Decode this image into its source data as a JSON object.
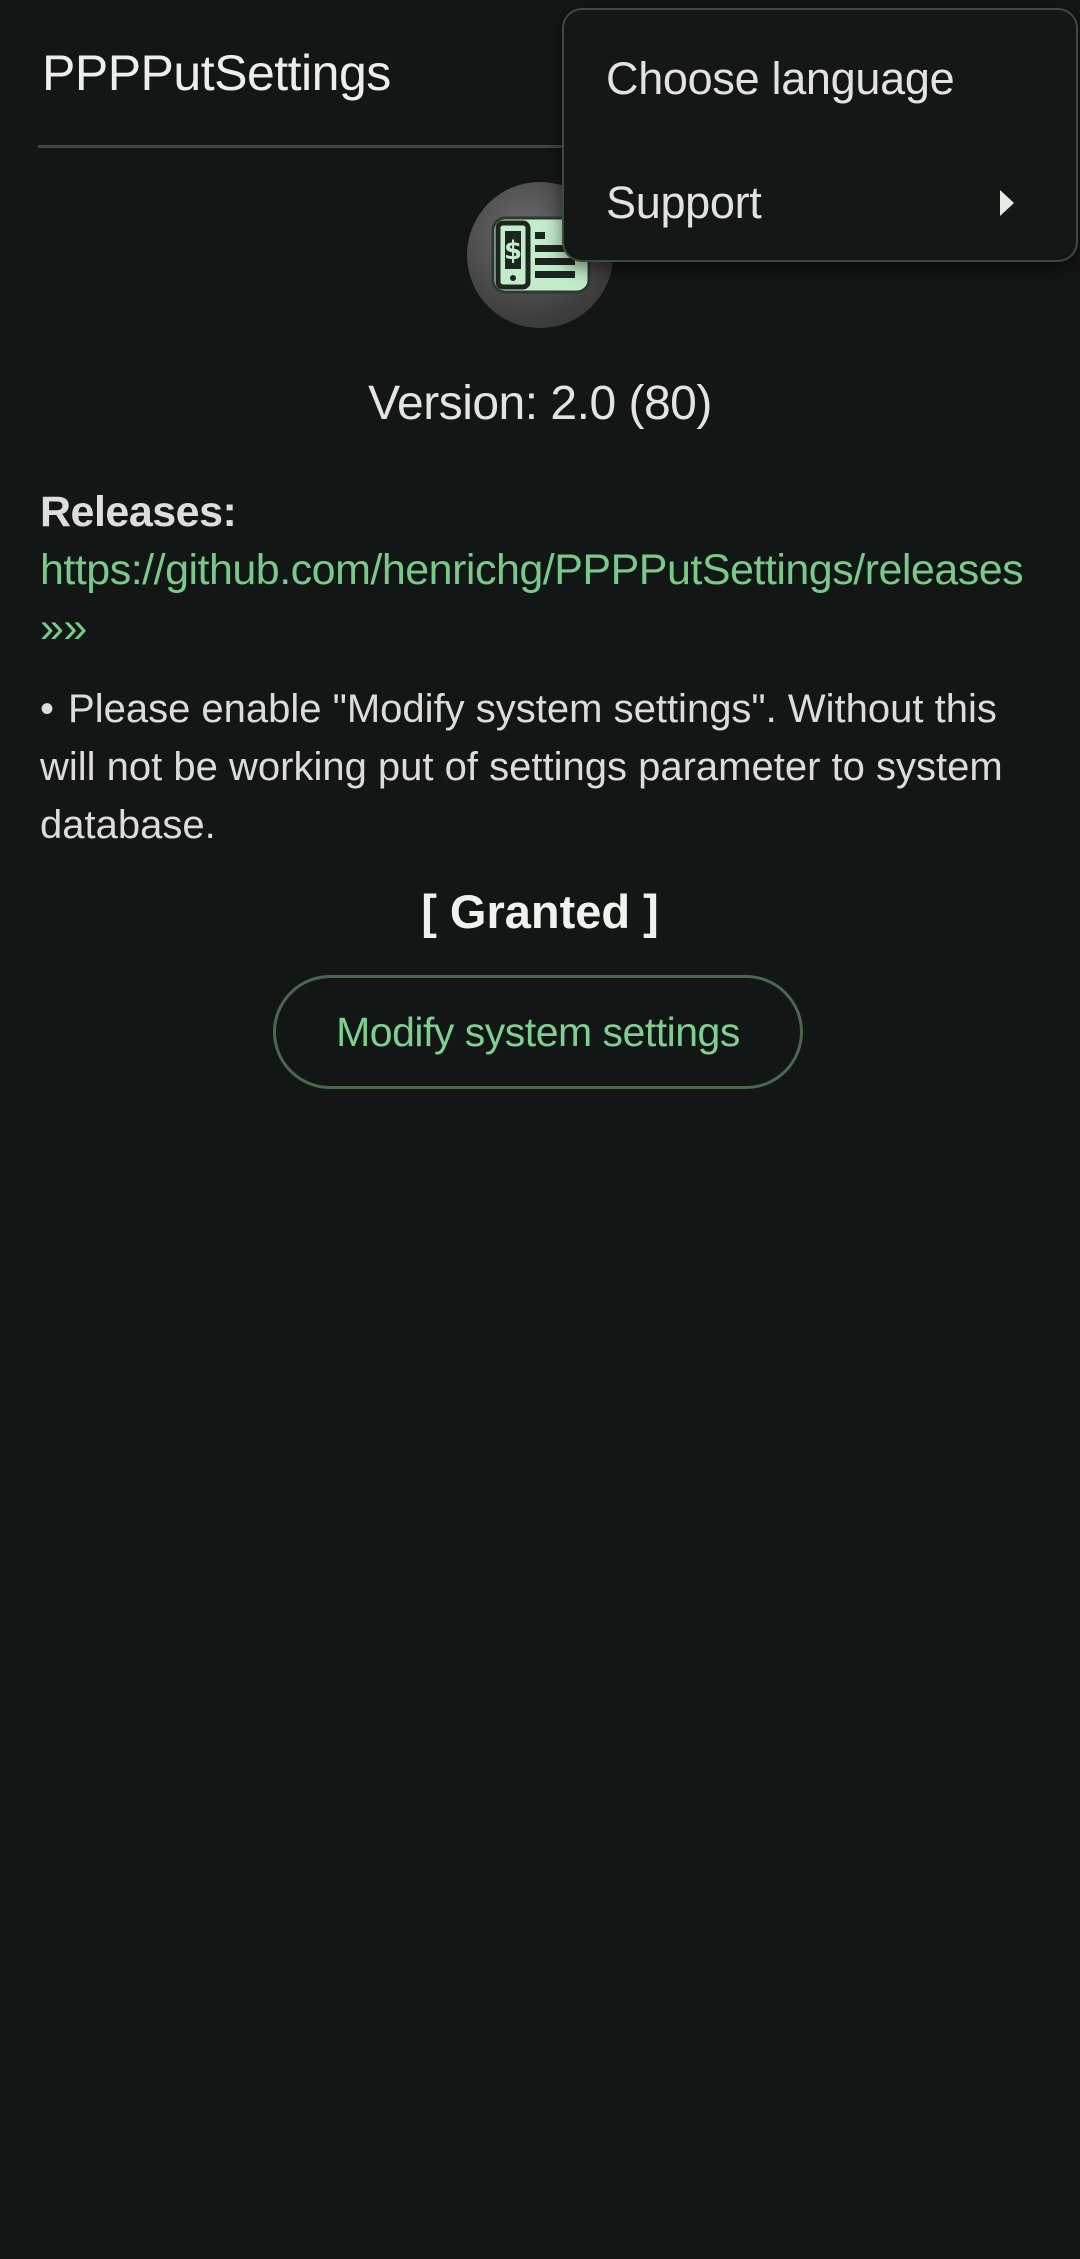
{
  "app": {
    "title": "PPPPutSettings"
  },
  "about": {
    "version_text": "Version: 2.0 (80)",
    "releases_label": "Releases:",
    "releases_link": "https://github.com/henrichg/PPPPutSettings/releases »»"
  },
  "permission": {
    "bullet": "•",
    "notice": "Please enable \"Modify system settings\". Without this will not be working put of settings parameter to system database.",
    "status": "[ Granted ]",
    "button_label": "Modify system settings"
  },
  "overflow_menu": {
    "items": [
      {
        "label": "Choose language"
      },
      {
        "label": "Support",
        "has_submenu": true
      }
    ]
  },
  "icons": {
    "app_icon": "phone-settings-icon",
    "submenu_arrow": "chevron-right-icon"
  },
  "colors": {
    "background": "#121614",
    "accent": "#79c98a",
    "divider": "#3b4a3f"
  }
}
